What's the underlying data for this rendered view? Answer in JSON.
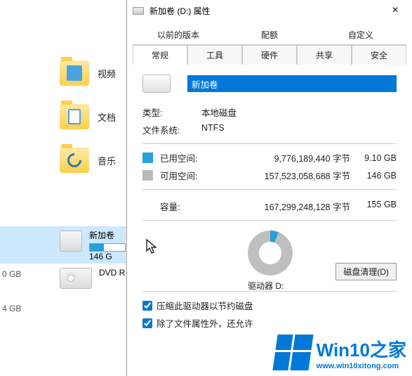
{
  "explorer": {
    "items": [
      {
        "label": "视频"
      },
      {
        "label": "文档"
      },
      {
        "label": "音乐"
      }
    ],
    "drives": [
      {
        "label": "新加卷",
        "sub": "146 G",
        "selected": true
      },
      {
        "label": "DVD R",
        "sub": ""
      }
    ],
    "side_sizes": [
      "0 GB",
      "4 GB"
    ]
  },
  "dialog": {
    "title": "新加卷 (D:) 属性",
    "close": "×",
    "tabs_row1": [
      "以前的版本",
      "配额",
      "自定义"
    ],
    "tabs_row2": [
      "常规",
      "工具",
      "硬件",
      "共享",
      "安全"
    ],
    "active_tab": "常规",
    "volume_name": "新加卷",
    "type_label": "类型:",
    "type_value": "本地磁盘",
    "fs_label": "文件系统:",
    "fs_value": "NTFS",
    "used_label": "已用空间:",
    "used_bytes": "9,776,189,440 字节",
    "used_gb": "9.10 GB",
    "free_label": "可用空间:",
    "free_bytes": "157,523,058,688 字节",
    "free_gb": "146 GB",
    "capacity_label": "容量:",
    "capacity_bytes": "167,299,248,128 字节",
    "capacity_gb": "155 GB",
    "drive_label": "驱动器 D:",
    "cleanup_button": "磁盘清理(D)",
    "compress_label": "压缩此驱动器以节约磁盘",
    "index_label": "除了文件属性外，还允许",
    "colors": {
      "used": "#26a0da",
      "free": "#b9b9b9"
    }
  },
  "watermark": {
    "brand": "Win10",
    "suffix": "之家",
    "url": "www.win10xitong.com"
  },
  "chart_data": {
    "type": "pie",
    "title": "驱动器 D:",
    "series": [
      {
        "name": "已用空间",
        "value": 9776189440,
        "display": "9.10 GB",
        "color": "#26a0da"
      },
      {
        "name": "可用空间",
        "value": 157523058688,
        "display": "146 GB",
        "color": "#b9b9b9"
      }
    ],
    "total": {
      "value": 167299248128,
      "display": "155 GB"
    }
  }
}
